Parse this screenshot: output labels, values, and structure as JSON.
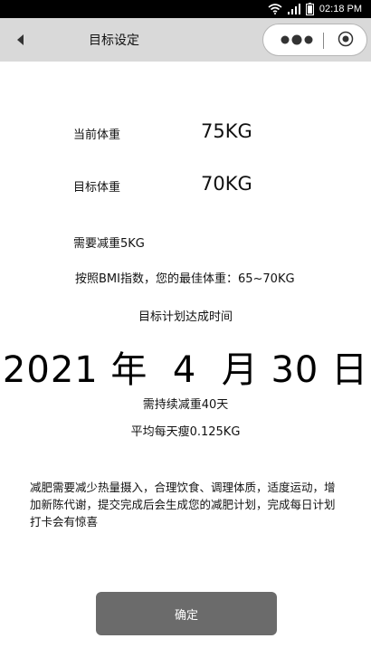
{
  "status_bar": {
    "time": "02:18 PM"
  },
  "nav": {
    "title": "目标设定"
  },
  "weight": {
    "current_label": "当前体重",
    "current_value": "75KG",
    "target_label": "目标体重",
    "target_value": "70KG",
    "need_loss": "需要减重5KG",
    "bmi_hint": "按照BMI指数，您的最佳体重：65~70KG"
  },
  "plan": {
    "title": "目标计划达成时间",
    "date": "2021 年  4  月 30 日",
    "days": "需持续减重40天",
    "daily": "平均每天瘦0.125KG"
  },
  "description": "减肥需要减少热量摄入，合理饮食、调理体质，适度运动，增加新陈代谢，提交完成后会生成您的减肥计划，完成每日计划打卡会有惊喜",
  "confirm_label": "确定",
  "icons": {
    "back": "chevron-left-icon",
    "more": "more-dots-icon",
    "close": "target-circle-icon",
    "wifi": "wifi-icon",
    "signal": "signal-icon",
    "battery": "battery-icon"
  },
  "colors": {
    "nav_bg": "#d9d9d9",
    "button_bg": "#6b6b6b",
    "status_bg": "#000000"
  }
}
